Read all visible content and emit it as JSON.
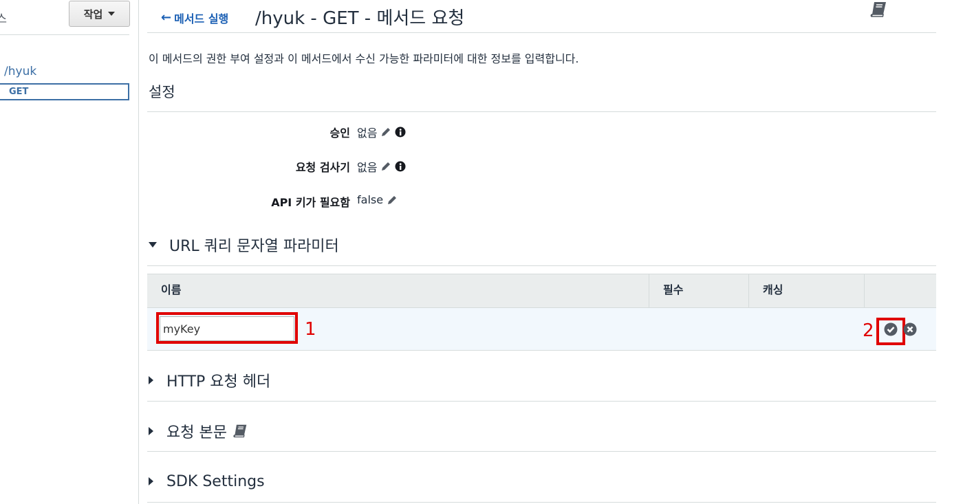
{
  "sidebar": {
    "clipped_title": "리소스",
    "actions_label": "작업",
    "resource_path": "/hyuk",
    "method": "GET"
  },
  "header": {
    "back_link": "메서드 실행",
    "title": "/hyuk - GET - 메서드 요청"
  },
  "description": "이 메서드의 권한 부여 설정과 이 메서드에서 수신 가능한 파라미터에 대한 정보를 입력합니다.",
  "settings": {
    "title": "설정",
    "rows": [
      {
        "label": "승인",
        "value": "없음"
      },
      {
        "label": "요청 검사기",
        "value": "없음"
      },
      {
        "label": "API 키가 필요함",
        "value": "false"
      }
    ]
  },
  "query_params": {
    "title": "URL 쿼리 문자열 파라미터",
    "columns": [
      "이름",
      "필수",
      "캐싱",
      ""
    ],
    "input_value": "myKey",
    "annotation_1": "1",
    "annotation_2": "2"
  },
  "sections": [
    {
      "title": "HTTP 요청 헤더"
    },
    {
      "title": "요청 본문"
    },
    {
      "title": "SDK Settings"
    }
  ],
  "colors": {
    "link": "#1a5fb4",
    "highlight": "#e00000",
    "row_bg": "#f2f8fd",
    "header_bg": "#eaeded"
  }
}
